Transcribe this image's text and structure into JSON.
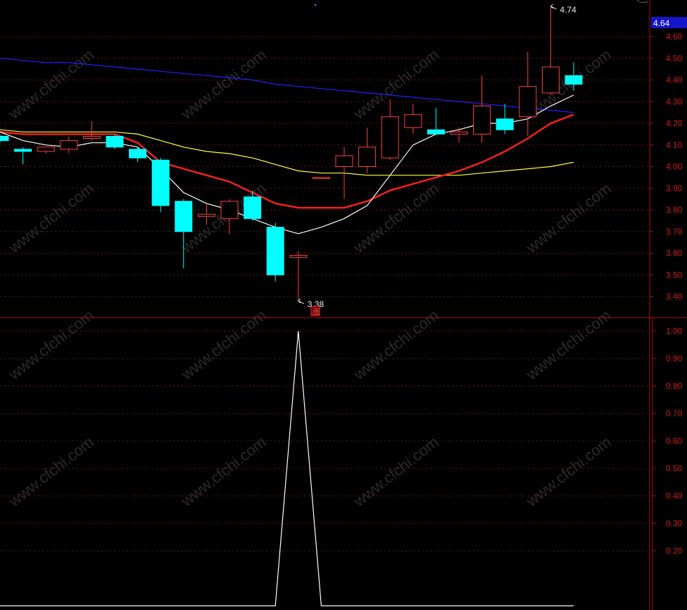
{
  "watermark": "www.cfchi.com",
  "current_price_tag": "4.64",
  "signal_mark": "涨",
  "colors": {
    "up": "#ff4040",
    "down": "#00ffff",
    "ma5": "#ffffff",
    "ma10": "#ff2020",
    "ma20": "#ffff40",
    "ma60": "#2020ff",
    "grid": "#7a1010",
    "axis": "#b01010",
    "indicator": "#ffffff",
    "tag_bg": "#1414c8"
  },
  "chart_data": [
    {
      "type": "candlestick",
      "title": "",
      "ylim": [
        3.33,
        4.76
      ],
      "yticks": [
        4.6,
        4.5,
        4.4,
        4.3,
        4.2,
        4.1,
        4.0,
        3.9,
        3.8,
        3.7,
        3.6,
        3.5,
        3.4
      ],
      "ytick_labels": [
        "4.60",
        "4.50",
        "4.40",
        "4.30",
        "4.20",
        "4.10",
        "4.00",
        "3.90",
        "3.80",
        "3.70",
        "3.60",
        "3.50",
        "3.40"
      ],
      "annotations": [
        {
          "label": "4.74",
          "value": 4.74,
          "index": 24
        },
        {
          "label": "3.38",
          "value": 3.38,
          "index": 13
        }
      ],
      "candles": [
        {
          "o": 4.14,
          "h": 4.15,
          "l": 4.11,
          "c": 4.12
        },
        {
          "o": 4.08,
          "h": 4.09,
          "l": 4.01,
          "c": 4.07
        },
        {
          "o": 4.07,
          "h": 4.09,
          "l": 4.06,
          "c": 4.09
        },
        {
          "o": 4.08,
          "h": 4.14,
          "l": 4.06,
          "c": 4.12
        },
        {
          "o": 4.13,
          "h": 4.21,
          "l": 4.12,
          "c": 4.14
        },
        {
          "o": 4.14,
          "h": 4.15,
          "l": 4.08,
          "c": 4.09
        },
        {
          "o": 4.08,
          "h": 4.09,
          "l": 4.02,
          "c": 4.04
        },
        {
          "o": 4.03,
          "h": 4.04,
          "l": 3.79,
          "c": 3.82
        },
        {
          "o": 3.84,
          "h": 3.85,
          "l": 3.53,
          "c": 3.7
        },
        {
          "o": 3.77,
          "h": 3.83,
          "l": 3.73,
          "c": 3.78
        },
        {
          "o": 3.76,
          "h": 3.85,
          "l": 3.69,
          "c": 3.84
        },
        {
          "o": 3.86,
          "h": 3.89,
          "l": 3.75,
          "c": 3.76
        },
        {
          "o": 3.72,
          "h": 3.74,
          "l": 3.47,
          "c": 3.5
        },
        {
          "o": 3.58,
          "h": 3.61,
          "l": 3.38,
          "c": 3.59
        },
        {
          "o": 3.95,
          "h": 3.95,
          "l": 3.95,
          "c": 3.95
        },
        {
          "o": 4.0,
          "h": 4.09,
          "l": 3.85,
          "c": 4.05
        },
        {
          "o": 4.0,
          "h": 4.18,
          "l": 3.97,
          "c": 4.09
        },
        {
          "o": 4.04,
          "h": 4.31,
          "l": 4.03,
          "c": 4.23
        },
        {
          "o": 4.18,
          "h": 4.29,
          "l": 4.15,
          "c": 4.24
        },
        {
          "o": 4.17,
          "h": 4.27,
          "l": 4.15,
          "c": 4.15
        },
        {
          "o": 4.15,
          "h": 4.18,
          "l": 4.11,
          "c": 4.16
        },
        {
          "o": 4.15,
          "h": 4.42,
          "l": 4.11,
          "c": 4.28
        },
        {
          "o": 4.22,
          "h": 4.29,
          "l": 4.15,
          "c": 4.17
        },
        {
          "o": 4.23,
          "h": 4.53,
          "l": 4.14,
          "c": 4.37
        },
        {
          "o": 4.34,
          "h": 4.74,
          "l": 4.33,
          "c": 4.46
        },
        {
          "o": 4.42,
          "h": 4.48,
          "l": 4.35,
          "c": 4.38
        }
      ],
      "ma5": [
        4.16,
        4.12,
        4.1,
        4.09,
        4.11,
        4.11,
        4.09,
        3.99,
        3.88,
        3.83,
        3.8,
        3.76,
        3.72,
        3.69,
        3.72,
        3.76,
        3.82,
        3.96,
        4.1,
        4.15,
        4.17,
        4.2,
        4.2,
        4.22,
        4.28,
        4.33
      ],
      "ma10": [
        4.16,
        4.15,
        4.15,
        4.15,
        4.15,
        4.15,
        4.11,
        4.02,
        3.99,
        3.96,
        3.93,
        3.88,
        3.83,
        3.81,
        3.81,
        3.81,
        3.84,
        3.89,
        3.92,
        3.95,
        3.98,
        4.02,
        4.07,
        4.13,
        4.2,
        4.24
      ],
      "ma20": [
        4.17,
        4.16,
        4.16,
        4.16,
        4.16,
        4.16,
        4.15,
        4.12,
        4.09,
        4.07,
        4.06,
        4.04,
        4.01,
        3.98,
        3.97,
        3.97,
        3.96,
        3.96,
        3.96,
        3.96,
        3.96,
        3.97,
        3.98,
        3.99,
        4.0,
        4.02
      ],
      "ma60": [
        4.5,
        4.49,
        4.48,
        4.48,
        4.47,
        4.46,
        4.45,
        4.44,
        4.43,
        4.42,
        4.41,
        4.4,
        4.38,
        4.37,
        4.36,
        4.35,
        4.34,
        4.33,
        4.32,
        4.31,
        4.3,
        4.29,
        4.28,
        4.27,
        4.26,
        4.25
      ]
    },
    {
      "type": "line",
      "title": "",
      "ylim": [
        0,
        1.02
      ],
      "yticks": [
        1.0,
        0.9,
        0.8,
        0.7,
        0.6,
        0.5,
        0.4,
        0.3,
        0.2
      ],
      "ytick_labels": [
        "1.00",
        "0.90",
        "0.80",
        "0.70",
        "0.60",
        "0.50",
        "0.40",
        "0.30",
        "0.20"
      ],
      "values": [
        0,
        0,
        0,
        0,
        0,
        0,
        0,
        0,
        0,
        0,
        0,
        0,
        0,
        1,
        0,
        0,
        0,
        0,
        0,
        0,
        0,
        0,
        0,
        0,
        0,
        0
      ]
    }
  ]
}
